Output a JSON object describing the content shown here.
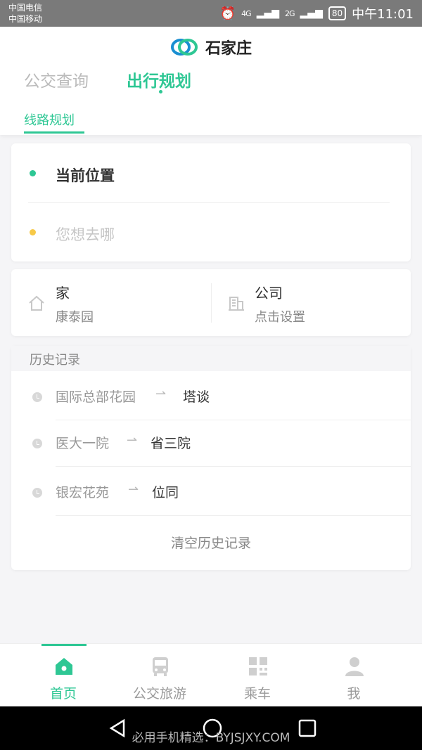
{
  "status_bar": {
    "carrier1": "中国电信",
    "carrier2": "中国移动",
    "network1": "4G",
    "network2": "2G",
    "battery": "80",
    "time": "中午11:01"
  },
  "header": {
    "city": "石家庄",
    "tabs": [
      "公交查询",
      "出行规划"
    ],
    "subtab": "线路规划"
  },
  "route": {
    "current": "当前位置",
    "destination_placeholder": "您想去哪"
  },
  "favorites": {
    "home_title": "家",
    "home_value": "康泰园",
    "work_title": "公司",
    "work_value": "点击设置"
  },
  "history": {
    "title": "历史记录",
    "items": [
      {
        "from": "国际总部花园",
        "to": "塔谈"
      },
      {
        "from": "医大一院",
        "to": "省三院"
      },
      {
        "from": "银宏花苑",
        "to": "位同"
      }
    ],
    "clear": "清空历史记录"
  },
  "bottom_nav": {
    "items": [
      "首页",
      "公交旅游",
      "乘车",
      "我"
    ],
    "active": "首页"
  },
  "watermark": "必用手机精选：BYJSJXY.COM",
  "colors": {
    "accent": "#2ec794",
    "destination_dot": "#f7c948"
  }
}
